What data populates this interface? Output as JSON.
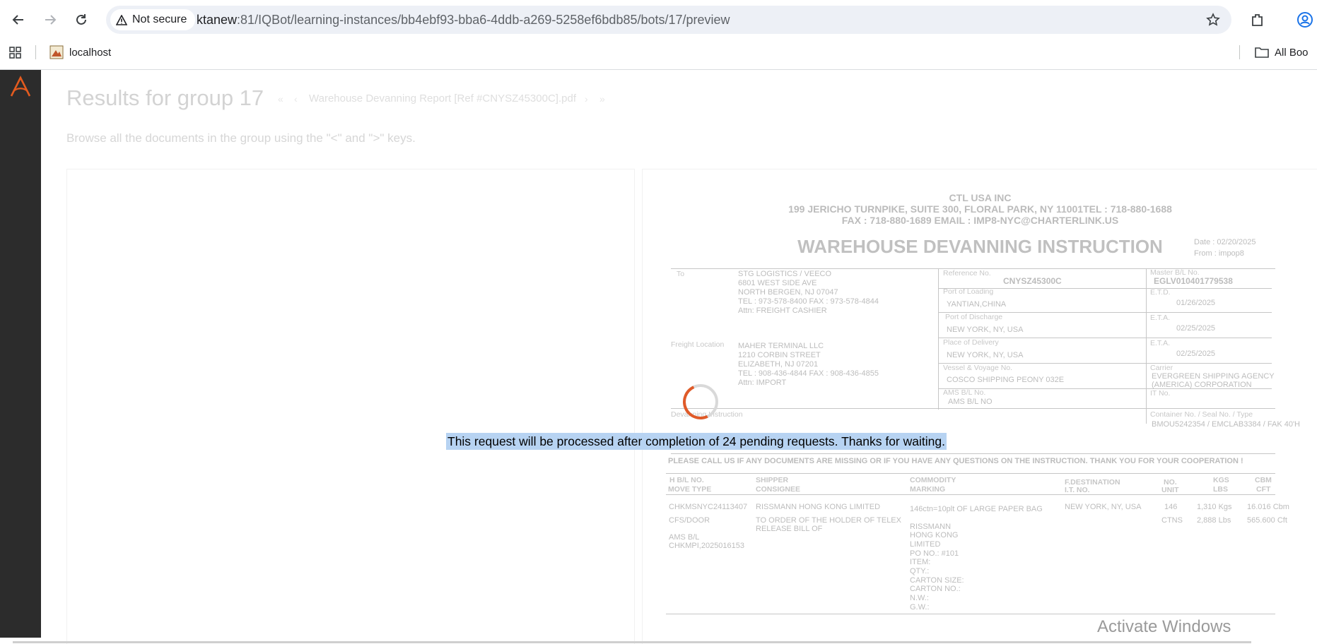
{
  "browser": {
    "security_label": "Not secure",
    "url_host": "ktanew",
    "url_rest": ":81/IQBot/learning-instances/bb4ebf93-bba6-4ddb-a269-5258ef6bdb85/bots/17/preview",
    "bookmark_localhost": "localhost",
    "all_bookmarks": "All Boo"
  },
  "app": {
    "title": "Results for group 17",
    "file_name": "Warehouse Devanning Report [Ref #CNYSZ45300C].pdf",
    "instruction": "Browse all the documents in the group using the \"<\" and \">\" keys.",
    "pending_message": "This request will be processed after completion of 24 pending requests. Thanks for waiting.",
    "accent_color": "#e35b1f"
  },
  "document": {
    "company": "CTL USA INC",
    "address": "199 JERICHO TURNPIKE, SUITE 300, FLORAL PARK, NY 11001TEL : 718-880-1688",
    "contact": "FAX : 718-880-1689 EMAIL : IMP8-NYC@CHARTERLINK.US",
    "heading": "WAREHOUSE DEVANNING INSTRUCTION",
    "date": "Date : 02/20/2025",
    "from": "From : impop8",
    "to_label": "To",
    "to_lines": [
      "STG LOGISTICS / VEECO",
      "6801 WEST SIDE AVE",
      "NORTH BERGEN, NJ 07047",
      "TEL : 973-578-8400  FAX : 973-578-4844",
      "Attn: FREIGHT CASHIER"
    ],
    "freight_label": "Freight Location",
    "freight_lines": [
      "MAHER TERMINAL LLC",
      "1210 CORBIN STREET",
      "ELIZABETH, NJ 07201",
      "TEL : 908-436-4844  FAX : 908-436-4855",
      "Attn: IMPORT"
    ],
    "ref_label": "Reference No.",
    "ref_value": "CNYSZ45300C",
    "pol_label": "Port of Loading",
    "pol_value": "YANTIAN,CHINA",
    "pod_label": "Port of Discharge",
    "pod_value": "NEW YORK, NY, USA",
    "podel_label": "Place of Delivery",
    "podel_value": "NEW YORK, NY, USA",
    "vessel_label": "Vessel & Voyage No.",
    "vessel_value": "COSCO SHIPPING PEONY 032E",
    "ams_label": "AMS B/L No.",
    "ams_value": "AMS B/L NO",
    "master_label": "Master B/L No.",
    "master_value": "EGLV010401779538",
    "etd_label": "E.T.D.",
    "etd_value": "01/26/2025",
    "eta1_label": "E.T.A.",
    "eta1_value": "02/25/2025",
    "eta2_label": "E.T.A.",
    "eta2_value": "02/25/2025",
    "carrier_label": "Carrier",
    "carrier_value1": "EVERGREEN SHIPPING AGENCY",
    "carrier_value2": "(AMERICA) CORPORATION",
    "it_label": "IT No.",
    "devanning_label": "Devanning Instruction",
    "container_label": "Container No. / Seal No. / Type",
    "container_value": "BMOU5242354 / EMCLAB3384 / FAK 40'H",
    "notice": "PLEASE CALL US IF ANY DOCUMENTS ARE MISSING OR IF YOU HAVE ANY QUESTIONS ON THE INSTRUCTION.  THANK YOU FOR YOUR COOPERATION !",
    "col_hbl": "H B/L NO.",
    "col_move": "MOVE TYPE",
    "col_shipper": "SHIPPER",
    "col_consignee": "CONSIGNEE",
    "col_commodity": "COMMODITY",
    "col_marking": "MARKING",
    "col_fdest": "F.DESTINATION",
    "col_itno": "I.T. NO.",
    "col_no": "NO.",
    "col_unit": "UNIT",
    "col_kgs": "KGS",
    "col_lbs": "LBS",
    "col_cbm": "CBM",
    "col_cft": "CFT",
    "row_hbl": "CHKMSNYC24113407",
    "row_move": "CFS/DOOR",
    "row_ams1": "AMS B/L",
    "row_ams2": "CHKMPI,2025016153",
    "row_shipper": "RISSMANN HONG KONG LIMITED",
    "row_consignee1": "TO ORDER OF THE HOLDER OF TELEX",
    "row_consignee2": "RELEASE BILL OF",
    "row_commodity": "146ctn=10plt OF LARGE PAPER BAG",
    "row_marking": [
      "RISSMANN",
      "HONG KONG",
      "LIMITED",
      "PO NO.: #101",
      "ITEM:",
      "QTY.:",
      "CARTON SIZE:",
      "CARTON NO.:",
      "N.W.:",
      "G.W.:"
    ],
    "row_dest": "NEW YORK, NY, USA",
    "row_no": "146",
    "row_unit": "CTNS",
    "row_kgs": "1,310 Kgs",
    "row_lbs": "2,888 Lbs",
    "row_cbm": "16.016 Cbm",
    "row_cft": "565.600 Cft"
  },
  "watermark": "Activate Windows"
}
